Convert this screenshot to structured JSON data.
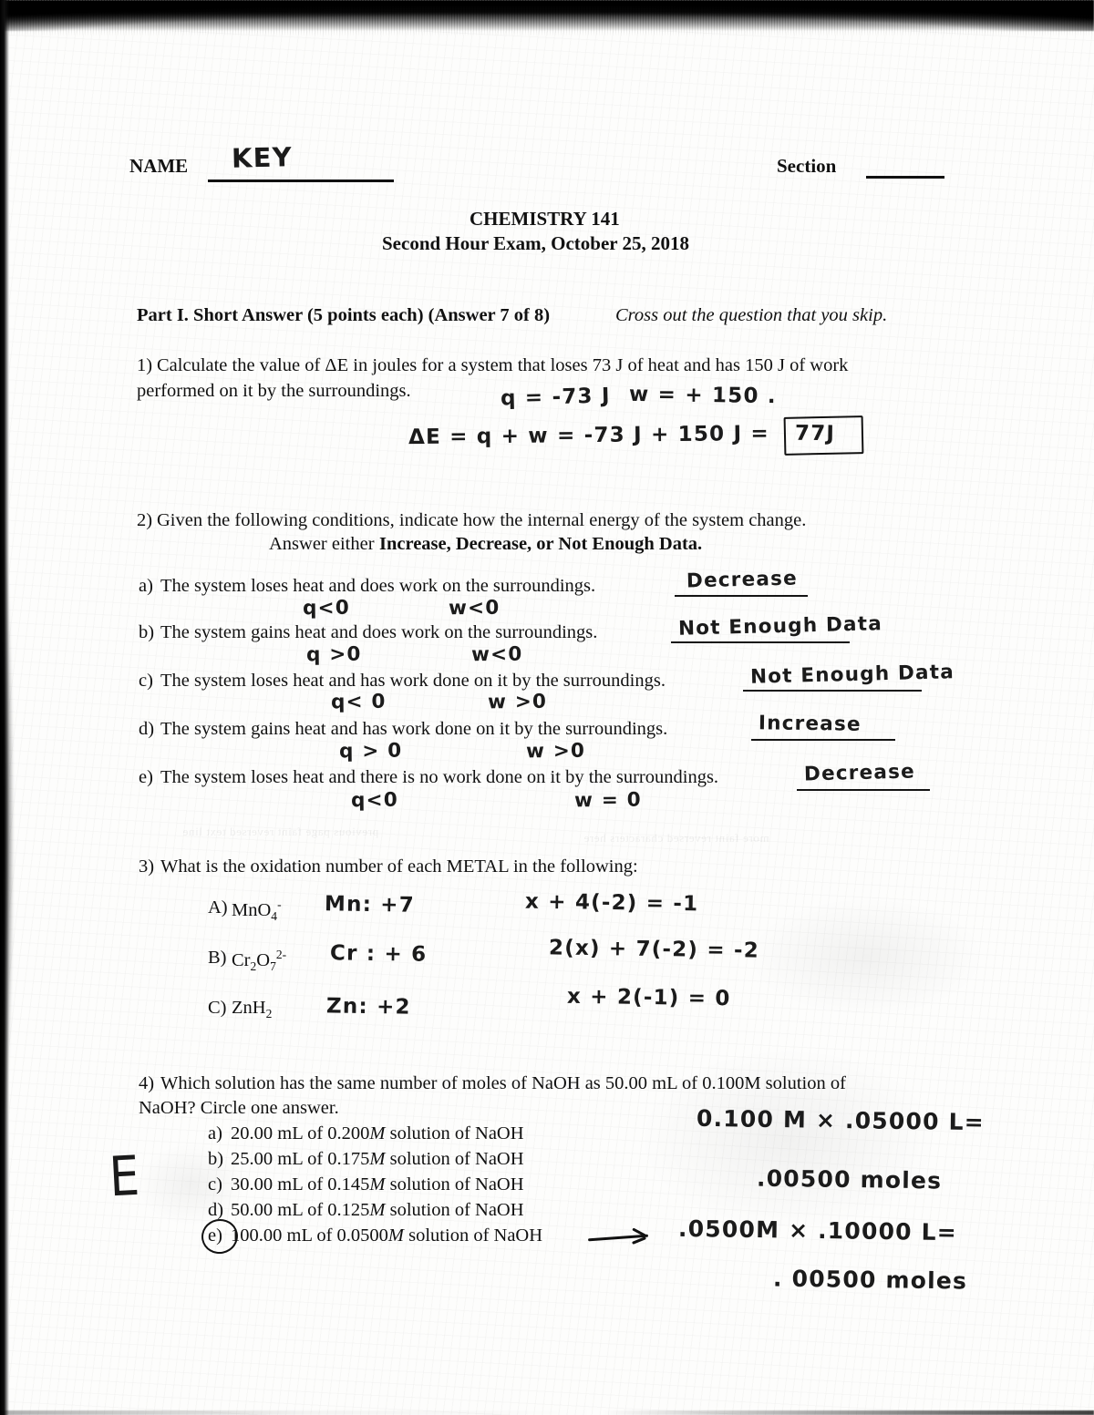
{
  "header": {
    "name_label": "NAME",
    "name_value": "KEY",
    "section_label": "Section",
    "section_value": "",
    "course": "CHEMISTRY 141",
    "exam_title": "Second Hour Exam, October 25, 2018"
  },
  "part_one": {
    "heading_bold": "Part I. Short Answer (5 points each)  (Answer 7 of 8)",
    "heading_italic": "Cross out the question that you skip."
  },
  "q1": {
    "number": "1)",
    "text_line1": "Calculate the value of ΔE in joules for a system that loses 73 J of heat and has 150 J of work",
    "text_line2": "performed on it by the surroundings.",
    "hw_q": "q = -73 J",
    "hw_w": "w = + 150 .",
    "hw_work": "ΔE = q + w  =  -73 J + 150 J =",
    "hw_answer": "77J"
  },
  "q2": {
    "number": "2)",
    "text_line1": "Given the following conditions, indicate how the internal energy of the system change.",
    "text_line2_plain": "Answer either ",
    "text_line2_bold": "Increase, Decrease, or Not Enough Data.",
    "items": [
      {
        "label": "a)",
        "text": "The system loses heat and does work on the surroundings.",
        "answer": "Decrease",
        "note_q": "q<0",
        "note_w": "w<0"
      },
      {
        "label": "b)",
        "text": "The system gains heat and does work on the surroundings.",
        "answer": "Not Enough Data",
        "note_q": "q >0",
        "note_w": "w<0"
      },
      {
        "label": "c)",
        "text": "The system loses heat and has work done on it by the surroundings.",
        "answer": "Not Enough Data",
        "note_q": "q< 0",
        "note_w": "w >0"
      },
      {
        "label": "d)",
        "text": "The system gains heat and has work done on it by the surroundings.",
        "answer": "Increase",
        "note_q": "q > 0",
        "note_w": "w >0"
      },
      {
        "label": "e)",
        "text": "The system loses heat and there is no work done on it by the surroundings.",
        "answer": "Decrease",
        "note_q": "q<0",
        "note_w": "w = 0"
      }
    ]
  },
  "q3": {
    "number": "3)",
    "text": "What is the oxidation number of each METAL in the following:",
    "rows": [
      {
        "label": "A)",
        "formula_parts": [
          "MnO",
          "4",
          "-"
        ],
        "answer": "Mn: +7",
        "work": "x + 4(-2) = -1"
      },
      {
        "label": "B)",
        "formula_parts": [
          "Cr",
          "2",
          "O",
          "7",
          "2-"
        ],
        "answer": "Cr : + 6",
        "work": "2(x) + 7(-2) = -2"
      },
      {
        "label": "C)",
        "formula_parts": [
          "ZnH",
          "2"
        ],
        "answer": "Zn: +2",
        "work": "x + 2(-1) = 0"
      }
    ]
  },
  "q4": {
    "number": "4)",
    "text_line1": "Which solution has the same number of moles of NaOH as 50.00 mL of 0.100M solution of",
    "text_line2": "NaOH? Circle one answer.",
    "options": [
      {
        "label": "a)",
        "text_pre": "20.00 mL of 0.200",
        "m": "M",
        "text_post": " solution of NaOH"
      },
      {
        "label": "b)",
        "text_pre": "25.00 mL of 0.175",
        "m": "M",
        "text_post": " solution of NaOH"
      },
      {
        "label": "c)",
        "text_pre": "30.00 mL of 0.145",
        "m": "M",
        "text_post": " solution of NaOH"
      },
      {
        "label": "d)",
        "text_pre": "50.00 mL of 0.125",
        "m": "M",
        "text_post": " solution of NaOH"
      },
      {
        "label": "e)",
        "text_pre": "100.00 mL of 0.0500",
        "m": "M",
        "text_post": " solution of NaOH"
      }
    ],
    "circled_option": "e)",
    "hw_calc_line1": "0.100 M × .05000 L=",
    "hw_calc_line2": ".00500  moles",
    "hw_calc_line3": ".0500M × .10000 L=",
    "hw_calc_line4": ". 00500 moles",
    "margin_mark": "E"
  },
  "colors": {
    "ink": "#111111",
    "pencil": "#1b1b1b",
    "paper": "#fdfdfc",
    "scan_edge": "#060606"
  }
}
